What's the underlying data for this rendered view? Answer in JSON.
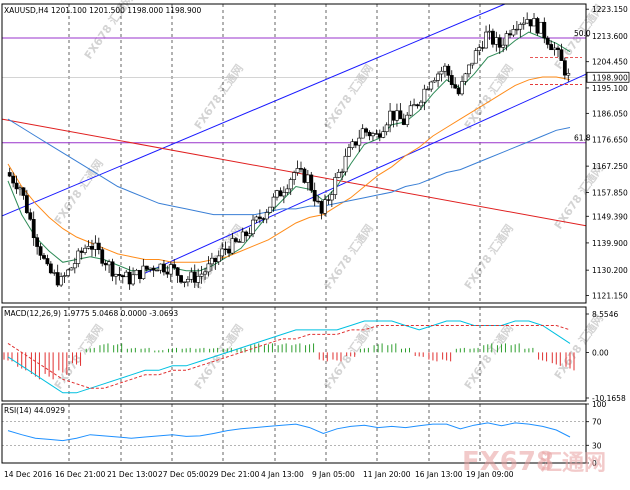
{
  "header": {
    "symbol_line": "XAUUSD,H4  1201.100 1201.500 1198.000 1198.900"
  },
  "colors": {
    "candle": "#000000",
    "channel": "#1a1aff",
    "trend_red": "#e02020",
    "fib_line": "#9933cc",
    "ma_fast": "#2e8b57",
    "ma_mid": "#ff8c1a",
    "ma_slow": "#3a7fd5",
    "macd_line": "#00c0e0",
    "macd_signal": "#e03030",
    "macd_hist_pos": "#2e9e2e",
    "macd_hist_neg": "#e03030",
    "rsi_line": "#1e90ff",
    "grid": "#000000",
    "watermark": "#d4d4d4"
  },
  "chart_data": [
    {
      "type": "candlestick",
      "title": "XAUUSD,H4",
      "ohlc_now": {
        "open": 1201.1,
        "high": 1201.5,
        "low": 1198.0,
        "close": 1198.9
      },
      "current_price_label": "1198.900",
      "y_ticks": [
        "1223.150",
        "1213.600",
        "1204.450",
        "1195.100",
        "1186.050",
        "1176.650",
        "1167.250",
        "1157.850",
        "1149.390",
        "1139.900",
        "1130.200",
        "1121.150"
      ],
      "y_tick_values": [
        1223.15,
        1213.6,
        1204.45,
        1195.1,
        1186.05,
        1176.65,
        1167.25,
        1157.85,
        1149.39,
        1139.9,
        1130.2,
        1121.15
      ],
      "ylim": [
        1118.5,
        1225
      ],
      "x_ticks": [
        "14 Dec 2016",
        "16 Dec 21:00",
        "21 Dec 13:00",
        "27 Dec 05:00",
        "29 Dec 21:00",
        "4 Jan 13:00",
        "9 Jan 05:00",
        "11 Jan 20:00",
        "16 Jan 13:00",
        "19 Jan 09:00"
      ],
      "fib_levels": [
        {
          "label": "50.0",
          "price": 1212.9
        },
        {
          "label": "61.8",
          "price": 1175.6
        }
      ],
      "close_path": [
        1165,
        1160,
        1144,
        1130,
        1126,
        1133,
        1140,
        1135,
        1129,
        1127,
        1130,
        1132,
        1131,
        1127,
        1128,
        1132,
        1138,
        1140,
        1146,
        1152,
        1158,
        1165,
        1163,
        1150,
        1162,
        1172,
        1180,
        1178,
        1186,
        1183,
        1190,
        1199,
        1202,
        1193,
        1205,
        1214,
        1210,
        1218,
        1220,
        1216,
        1209,
        1199
      ],
      "series": [
        {
          "name": "MA fast",
          "values": [
            1162,
            1150,
            1142,
            1137,
            1133,
            1134,
            1135,
            1134,
            1132,
            1130,
            1130,
            1131,
            1131,
            1130,
            1130,
            1132,
            1135,
            1138,
            1144,
            1150,
            1155,
            1160,
            1159,
            1155,
            1160,
            1168,
            1175,
            1177,
            1182,
            1183,
            1187,
            1193,
            1198,
            1195,
            1200,
            1206,
            1208,
            1212,
            1215,
            1213,
            1211,
            1208
          ]
        },
        {
          "name": "MA mid",
          "values": [
            1168,
            1160,
            1154,
            1149,
            1145,
            1142,
            1140,
            1138,
            1136,
            1135,
            1134,
            1134,
            1133,
            1133,
            1133,
            1134,
            1135,
            1137,
            1139,
            1141,
            1144,
            1147,
            1149,
            1150,
            1153,
            1156,
            1160,
            1164,
            1167,
            1171,
            1174,
            1178,
            1181,
            1184,
            1187,
            1190,
            1193,
            1196,
            1198,
            1199,
            1199,
            1198
          ]
        },
        {
          "name": "MA slow",
          "values": [
            1184,
            1181,
            1178,
            1175,
            1172,
            1169,
            1166,
            1163,
            1160,
            1158,
            1156,
            1154,
            1153,
            1152,
            1151,
            1150,
            1150,
            1150,
            1150,
            1151,
            1152,
            1152,
            1153,
            1153,
            1154,
            1155,
            1156,
            1157,
            1158,
            1160,
            1161,
            1163,
            1165,
            1166,
            1168,
            1170,
            1172,
            1174,
            1176,
            1178,
            1180,
            1181
          ]
        }
      ]
    },
    {
      "type": "bar",
      "title": "MACD(12,26,9) 1.9775 5.0468 0.0000 -3.0693",
      "y_ticks": [
        "8.5546",
        "0.00",
        "-10.1658"
      ],
      "ylim": [
        -10.1658,
        8.5546
      ],
      "histogram": [
        -2,
        -4,
        -6,
        -6,
        -5,
        -3,
        1,
        2,
        2,
        1,
        1,
        0.5,
        1,
        1,
        1,
        1,
        1,
        1,
        2,
        2,
        2,
        2,
        2,
        -2,
        -2,
        -1,
        1,
        2,
        2,
        1,
        -1,
        -2,
        -2,
        1,
        1,
        2,
        2,
        2,
        1,
        -2,
        -3,
        -4
      ],
      "series": [
        {
          "name": "MACD",
          "values": [
            -1,
            -3,
            -5,
            -7,
            -9,
            -9,
            -8,
            -7,
            -6,
            -5,
            -4,
            -4,
            -3,
            -3,
            -2,
            -1,
            0,
            1,
            2,
            3,
            4,
            5,
            5,
            5,
            5,
            6,
            7,
            7,
            7,
            6,
            5,
            6,
            7,
            7,
            6,
            6,
            6,
            7,
            7,
            6,
            4,
            2
          ]
        },
        {
          "name": "Signal",
          "values": [
            2,
            0,
            -2,
            -4,
            -6,
            -7,
            -8,
            -8,
            -7,
            -6,
            -5,
            -5,
            -4,
            -4,
            -3,
            -2,
            -1,
            0,
            1,
            2,
            3,
            3,
            4,
            4,
            4,
            5,
            5,
            6,
            6,
            6,
            6,
            6,
            6,
            6,
            6,
            6,
            6,
            6,
            6,
            6,
            6,
            5
          ]
        }
      ]
    },
    {
      "type": "line",
      "title": "RSI(14) 44.0929",
      "y_ticks": [
        "100",
        "70",
        "30",
        "0"
      ],
      "ylim": [
        0,
        100
      ],
      "series": [
        {
          "name": "RSI",
          "values": [
            55,
            48,
            42,
            40,
            38,
            42,
            48,
            46,
            44,
            42,
            44,
            46,
            48,
            45,
            46,
            50,
            55,
            58,
            60,
            62,
            64,
            66,
            60,
            50,
            58,
            62,
            64,
            60,
            62,
            60,
            63,
            66,
            66,
            58,
            64,
            68,
            63,
            68,
            66,
            62,
            56,
            44
          ]
        }
      ]
    }
  ],
  "watermark_text": "FX678 汇通网",
  "watermark_logo": "FX678",
  "watermark_logo_cn": "汇通网"
}
